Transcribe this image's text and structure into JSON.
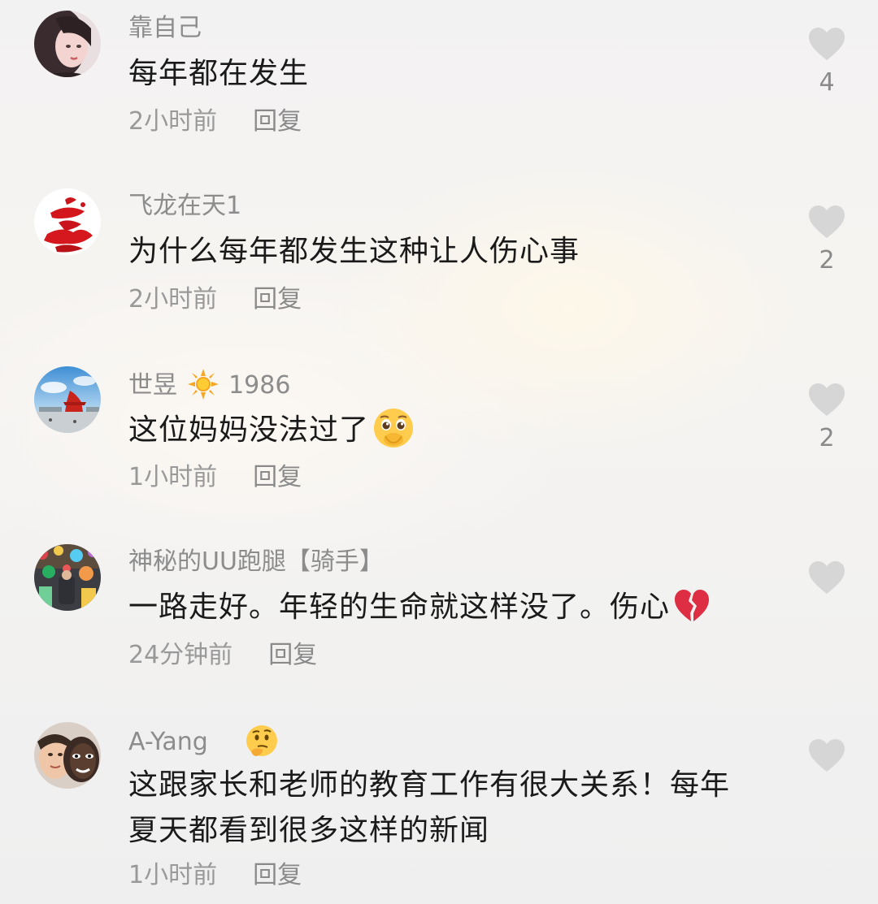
{
  "comments": [
    {
      "username": "靠自己",
      "text": "每年都在发生",
      "time": "2小时前",
      "reply": "回复",
      "likes": "4",
      "avatar_icon": "avatar-girl-photo"
    },
    {
      "username": "飞龙在天1",
      "text": "为什么每年都发生这种让人伤心事",
      "time": "2小时前",
      "reply": "回复",
      "likes": "2",
      "avatar_icon": "avatar-red-calligraphy"
    },
    {
      "username": "世昱",
      "username_suffix": "1986",
      "text": "这位妈妈没法过了",
      "time": "1小时前",
      "reply": "回复",
      "likes": "2",
      "avatar_icon": "avatar-landmark-sky"
    },
    {
      "username": "神秘的UU跑腿【骑手】",
      "text": "一路走好。年轻的生命就这样没了。伤心",
      "time": "24分钟前",
      "reply": "回复",
      "likes": "",
      "avatar_icon": "avatar-colorful-crowd"
    },
    {
      "username": "A-Yang",
      "text_line1": "这跟家长和老师的教育工作有很大关系！每年",
      "text_line2": "夏天都看到很多这样的新闻",
      "time": "1小时前",
      "reply": "回复",
      "likes": "",
      "avatar_icon": "avatar-two-faces"
    }
  ],
  "colors": {
    "heart": "#d4d4d4",
    "username": "#8c8c8c",
    "text": "#1a1a1a",
    "meta": "#999999"
  }
}
